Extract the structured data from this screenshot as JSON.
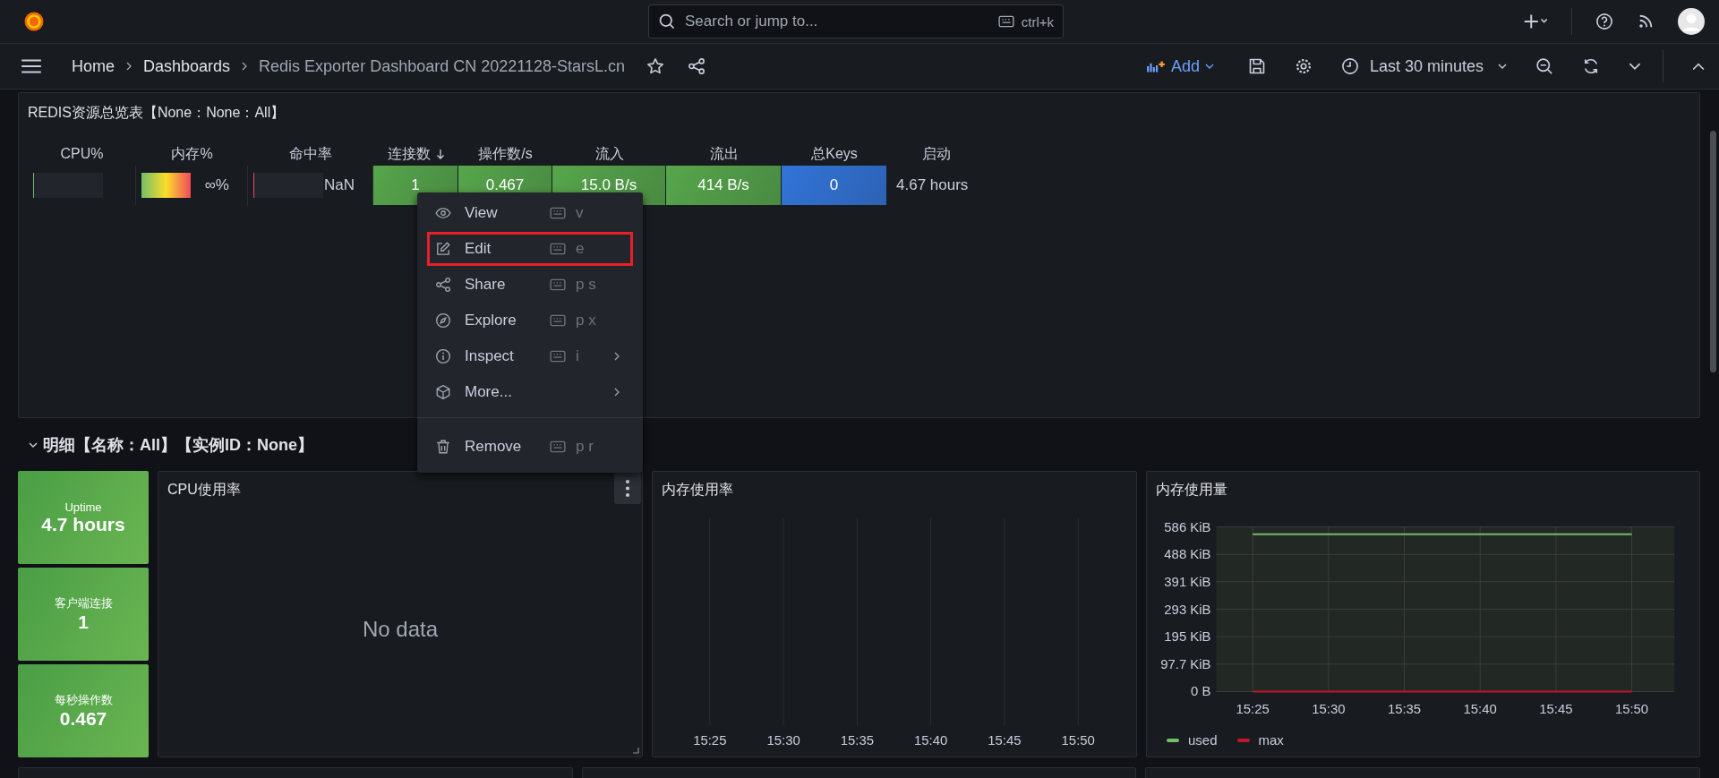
{
  "top_bar": {
    "search": {
      "placeholder": "Search or jump to...",
      "shortcut": "ctrl+k"
    }
  },
  "breadcrumb": [
    {
      "label": "Home",
      "current": false
    },
    {
      "label": "Dashboards",
      "current": false
    },
    {
      "label": "Redis Exporter Dashboard CN 20221128-StarsL.cn",
      "current": true
    }
  ],
  "toolbar": {
    "add_label": "Add",
    "time_range": "Last 30 minutes"
  },
  "overview_panel": {
    "title": "REDIS资源总览表【None：None：All】",
    "columns": [
      {
        "label": "CPU%",
        "sorted": false
      },
      {
        "label": "内存%",
        "sorted": false
      },
      {
        "label": "命中率",
        "sorted": false
      },
      {
        "label": "连接数",
        "sorted": true
      },
      {
        "label": "操作数/s",
        "sorted": false
      },
      {
        "label": "流入",
        "sorted": false
      },
      {
        "label": "流出",
        "sorted": false
      },
      {
        "label": "总Keys",
        "sorted": false
      },
      {
        "label": "启动",
        "sorted": false
      }
    ],
    "row": [
      {
        "kind": "gauge",
        "level": 0,
        "color": "#73bf69"
      },
      {
        "kind": "gradient-gauge",
        "level": 1,
        "text": "∞%"
      },
      {
        "kind": "gauge",
        "level": 0,
        "color": "#f2495c",
        "text": "NaN"
      },
      {
        "kind": "colored",
        "color": "#56a64b",
        "text": "1"
      },
      {
        "kind": "colored",
        "color": "#56a64b",
        "text": "0.467"
      },
      {
        "kind": "colored",
        "color": "#56a64b",
        "text": "15.0 B/s"
      },
      {
        "kind": "colored",
        "color": "#56a64b",
        "text": "414 B/s"
      },
      {
        "kind": "colored",
        "color": "#3274d9",
        "text": "0"
      },
      {
        "kind": "plain",
        "text": "4.67 hours"
      }
    ]
  },
  "context_menu": [
    {
      "kind": "view",
      "label": "View",
      "shortcut": "v",
      "submenu": false,
      "outlined": false,
      "divider_before": false
    },
    {
      "kind": "edit",
      "label": "Edit",
      "shortcut": "e",
      "submenu": false,
      "outlined": true,
      "divider_before": false
    },
    {
      "kind": "share",
      "label": "Share",
      "shortcut": "p s",
      "submenu": false,
      "outlined": false,
      "divider_before": false
    },
    {
      "kind": "explore",
      "label": "Explore",
      "shortcut": "p x",
      "submenu": false,
      "outlined": false,
      "divider_before": false
    },
    {
      "kind": "inspect",
      "label": "Inspect",
      "shortcut": "i",
      "submenu": true,
      "outlined": false,
      "divider_before": false
    },
    {
      "kind": "more",
      "label": "More...",
      "submenu": true,
      "outlined": false,
      "divider_before": false
    },
    {
      "kind": "remove",
      "label": "Remove",
      "shortcut": "p r",
      "submenu": false,
      "outlined": false,
      "divider_before": true
    }
  ],
  "detail_row": {
    "title": "明细【名称：All】【实例ID：None】",
    "expanded": true
  },
  "stats": [
    {
      "label": "Uptime",
      "value": "4.7 hours"
    },
    {
      "label": "客户端连接",
      "value": "1"
    },
    {
      "label": "每秒操作数",
      "value": "0.467"
    }
  ],
  "cpu_panel": {
    "title": "CPU使用率",
    "message": "No data"
  },
  "memory_rate_panel": {
    "title": "内存使用率",
    "time_axis": [
      "15:25",
      "15:30",
      "15:35",
      "15:40",
      "15:45",
      "15:50"
    ]
  },
  "memory_usage_panel": {
    "title": "内存使用量",
    "chart_data": {
      "type": "line",
      "categories": [
        "15:25",
        "15:30",
        "15:35",
        "15:40",
        "15:45",
        "15:50"
      ],
      "series": [
        {
          "name": "used",
          "color": "#73bf69",
          "values": [
            560,
            560,
            560,
            560,
            560,
            560
          ]
        },
        {
          "name": "max",
          "color": "#c4162a",
          "values": [
            0,
            0,
            0,
            0,
            0,
            0
          ]
        }
      ],
      "ylim": [
        0,
        586
      ],
      "grid": true,
      "yticks": [
        {
          "value": 0,
          "label": "0 B"
        },
        {
          "value": 97.7,
          "label": "97.7 KiB"
        },
        {
          "value": 195,
          "label": "195 KiB"
        },
        {
          "value": 293,
          "label": "293 KiB"
        },
        {
          "value": 391,
          "label": "391 KiB"
        },
        {
          "value": 488,
          "label": "488 KiB"
        },
        {
          "value": 586,
          "label": "586 KiB"
        }
      ]
    }
  }
}
